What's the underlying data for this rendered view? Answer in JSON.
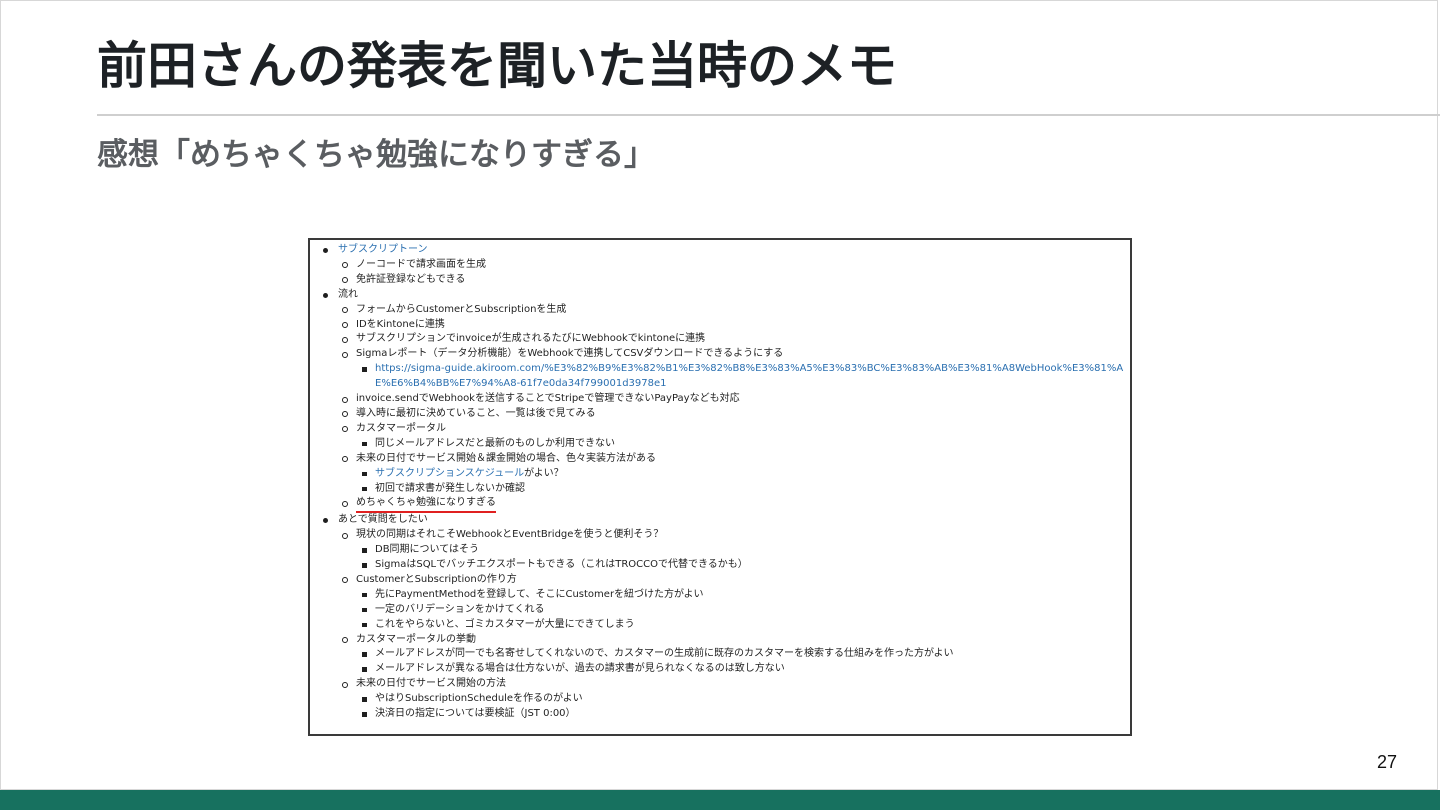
{
  "slide": {
    "title": "前田さんの発表を聞いた当時のメモ",
    "subtitle": "感想「めちゃくちゃ勉強になりすぎる」",
    "page_number": "27",
    "accent_color": "#17715f",
    "highlight_color": "#e02020",
    "link_color": "#2a6fb0"
  },
  "memo": {
    "items": [
      {
        "text": "サブスクリプトーン",
        "link": true,
        "children": [
          {
            "text": "ノーコードで請求画面を生成"
          },
          {
            "text": "免許証登録などもできる"
          }
        ]
      },
      {
        "text": "流れ",
        "children": [
          {
            "text": "フォームからCustomerとSubscriptionを生成"
          },
          {
            "text": "IDをKintoneに連携"
          },
          {
            "text": "サブスクリプションでinvoiceが生成されるたびにWebhookでkintoneに連携"
          },
          {
            "text": "Sigmaレポート（データ分析機能）をWebhookで連携してCSVダウンロードできるようにする",
            "children": [
              {
                "text": "https://sigma-guide.akiroom.com/%E3%82%B9%E3%82%B1%E3%82%B8%E3%83%A5%E3%83%BC%E3%83%AB%E3%81%A8WebHook%E3%81%AE%E6%B4%BB%E7%94%A8-61f7e0da34f799001d3978e1",
                "link": true,
                "url": true
              }
            ]
          },
          {
            "text": "invoice.sendでWebhookを送信することでStripeで管理できないPayPayなども対応"
          },
          {
            "text": "導入時に最初に決めていること、一覧は後で見てみる"
          },
          {
            "text": "カスタマーポータル",
            "children": [
              {
                "text": "同じメールアドレスだと最新のものしか利用できない"
              }
            ]
          },
          {
            "text": "未来の日付でサービス開始＆課金開始の場合、色々実装方法がある",
            "children": [
              {
                "link_text": "サブスクリプションスケジュール",
                "text": "がよい？"
              },
              {
                "text": "初回で請求書が発生しないか確認"
              }
            ]
          },
          {
            "text": "めちゃくちゃ勉強になりすぎる",
            "highlight": true
          }
        ]
      },
      {
        "text": "あとで質問をしたい",
        "children": [
          {
            "text": "現状の同期はそれこそWebhookとEventBridgeを使うと便利そう？",
            "children": [
              {
                "text": "DB同期についてはそう"
              },
              {
                "text": "SigmaはSQLでバッチエクスポートもできる（これはTROCCOで代替できるかも）"
              }
            ]
          },
          {
            "text": "CustomerとSubscriptionの作り方",
            "children": [
              {
                "text": "先にPaymentMethodを登録して、そこにCustomerを紐づけた方がよい"
              },
              {
                "text": "一定のバリデーションをかけてくれる"
              },
              {
                "text": "これをやらないと、ゴミカスタマーが大量にできてしまう"
              }
            ]
          },
          {
            "text": "カスタマーポータルの挙動",
            "children": [
              {
                "text": "メールアドレスが同一でも名寄せしてくれないので、カスタマーの生成前に既存のカスタマーを検索する仕組みを作った方がよい"
              },
              {
                "text": "メールアドレスが異なる場合は仕方ないが、過去の請求書が見られなくなるのは致し方ない"
              }
            ]
          },
          {
            "text": "未来の日付でサービス開始の方法",
            "children": [
              {
                "text": "やはりSubscriptionScheduleを作るのがよい"
              },
              {
                "text": "決済日の指定については要検証（JST 0:00）"
              }
            ]
          }
        ]
      }
    ]
  }
}
